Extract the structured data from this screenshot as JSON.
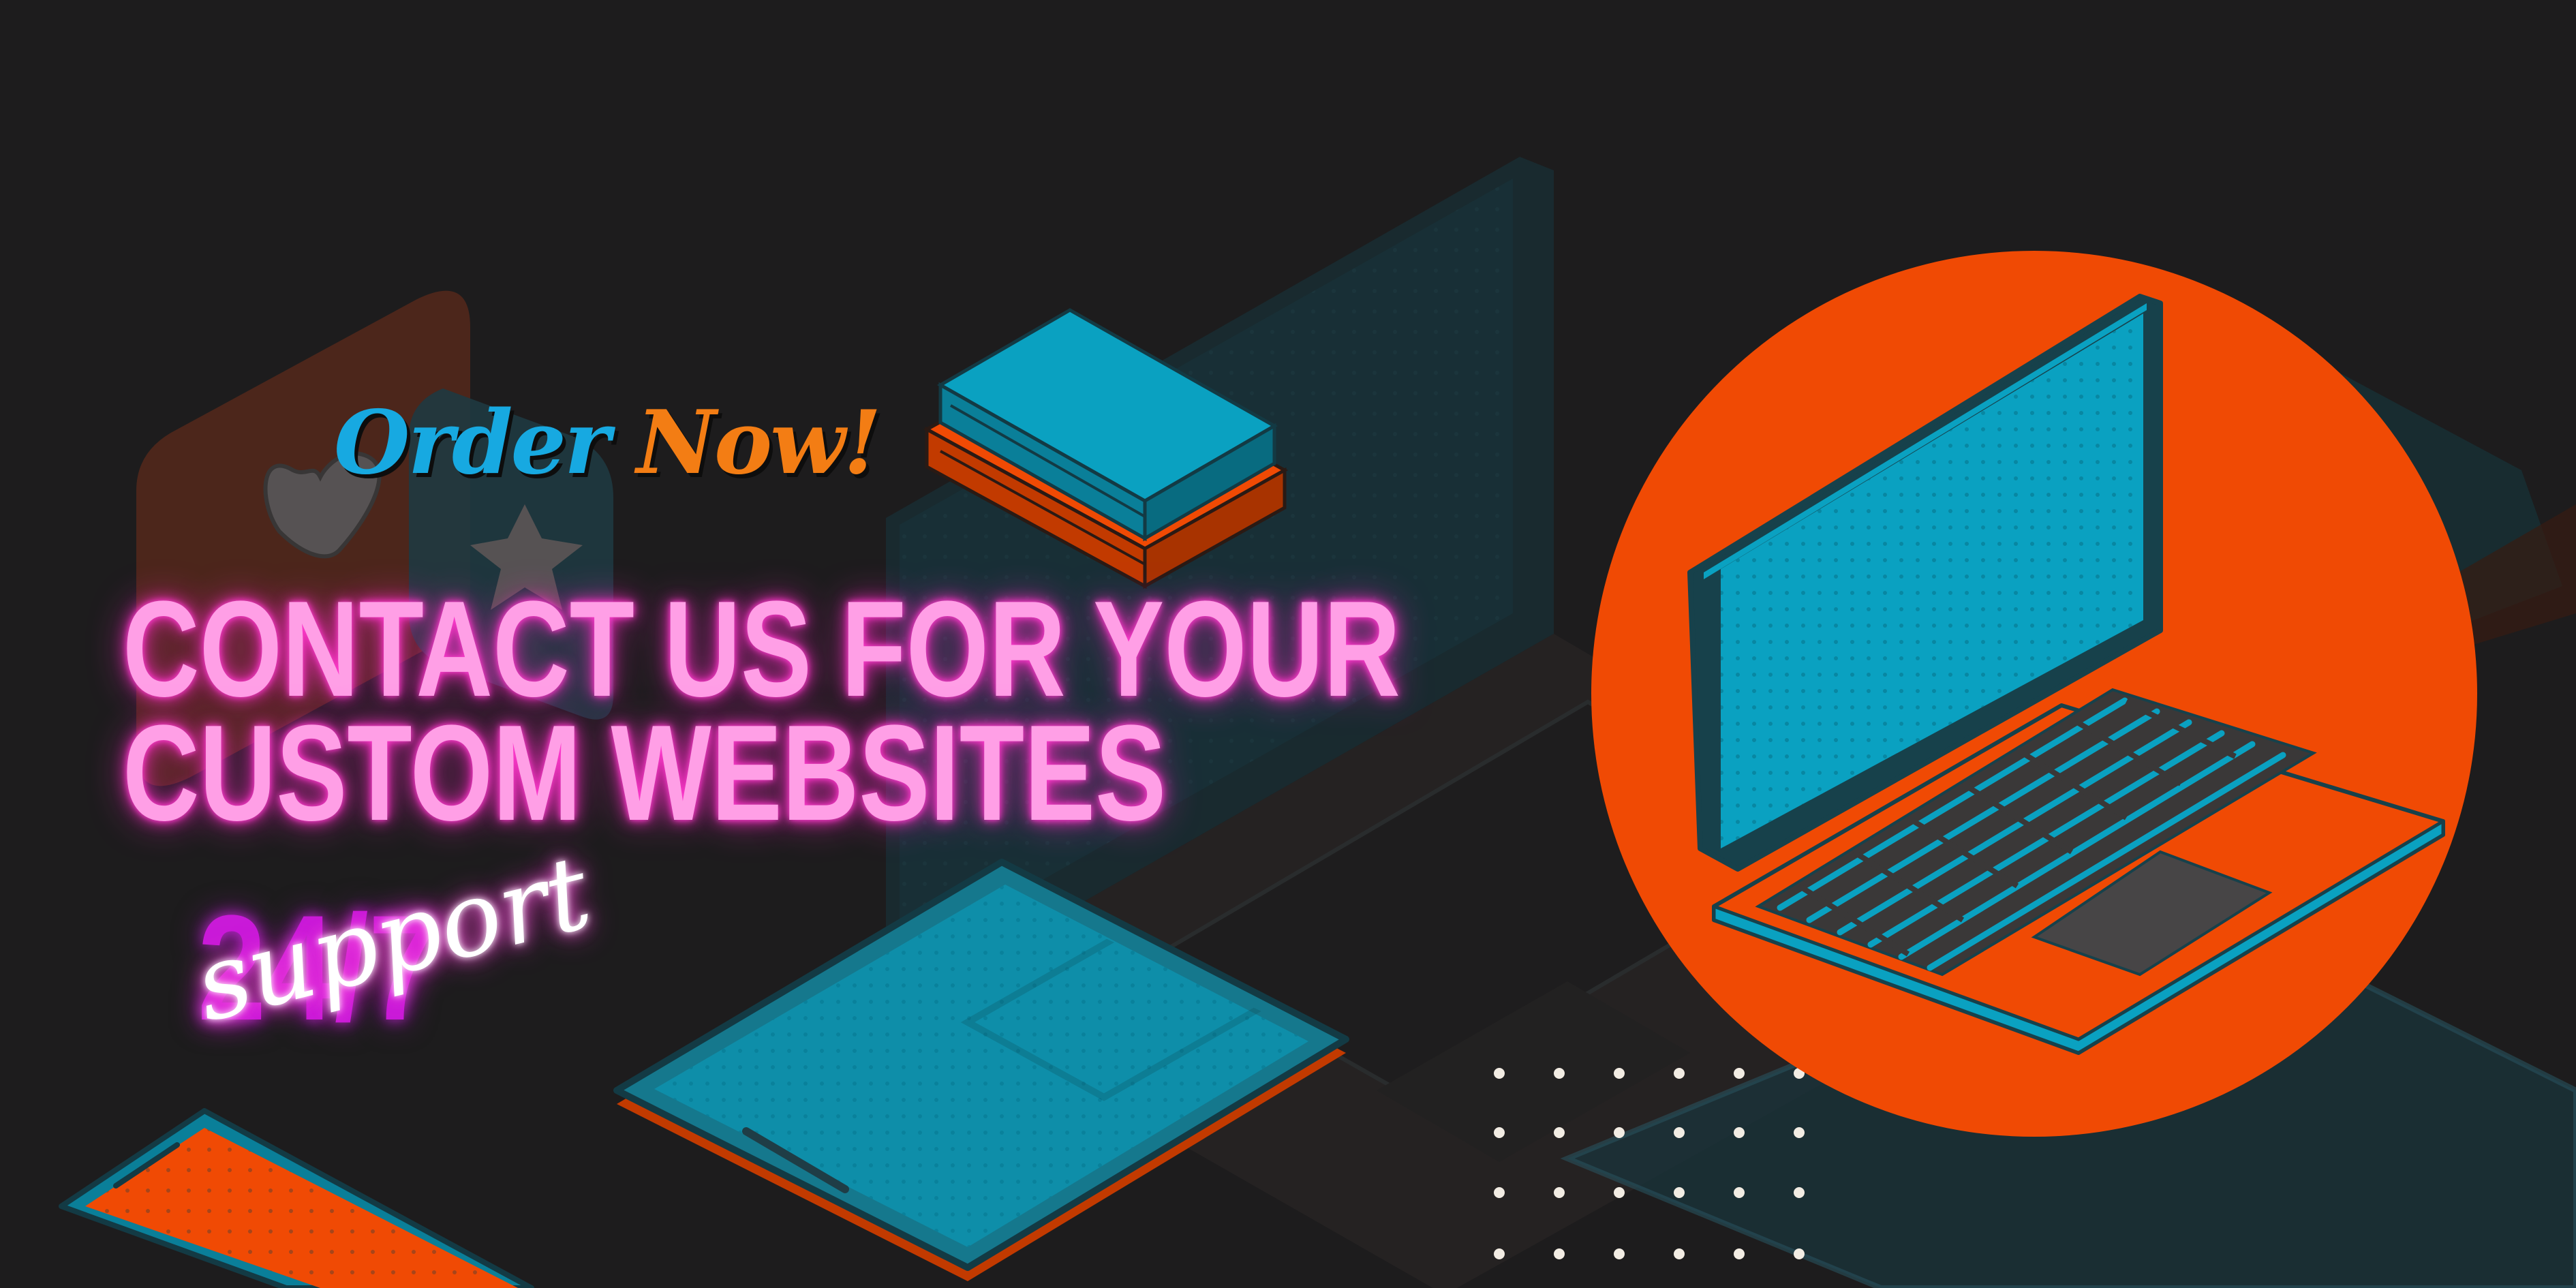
{
  "banner": {
    "cta": {
      "word1": "Order",
      "word2": "Now!"
    },
    "headline": {
      "line1": "Contact us for your",
      "line2": "custom websites"
    },
    "support": {
      "hours": "24/7",
      "label": "support"
    }
  },
  "palette": {
    "background": "#1d1c1d",
    "orange": "#f04a04",
    "cyan": "#0aa1c1",
    "neon_pink": "#ff9fe6",
    "neon_magenta": "#c91ad8",
    "cta_blue": "#17a9e1",
    "cta_orange": "#f37d14"
  },
  "icons": [
    "laptop-icon",
    "tablet-icon",
    "phone-icon",
    "book-stack-icon",
    "heart-icon",
    "star-icon",
    "dot-grid-decoration"
  ]
}
